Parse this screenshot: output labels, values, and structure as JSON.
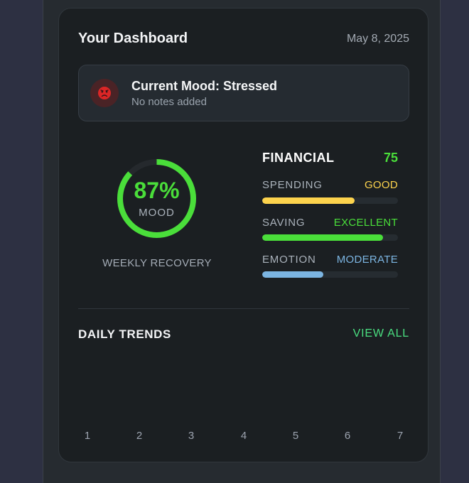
{
  "header": {
    "title": "Your Dashboard",
    "date": "May 8, 2025"
  },
  "current_mood": {
    "title": "Current Mood: Stressed",
    "notes": "No notes added",
    "icon": "stressed-face-icon",
    "icon_color": "#dc2626"
  },
  "mood_ring": {
    "percent": 87,
    "percent_label": "87%",
    "label": "MOOD",
    "caption": "WEEKLY RECOVERY",
    "color": "#4ade3a"
  },
  "financial": {
    "title": "FINANCIAL",
    "score": "75",
    "metrics": [
      {
        "label": "SPENDING",
        "rating": "GOOD",
        "level": 0.68,
        "color": "#fcd34d"
      },
      {
        "label": "SAVING",
        "rating": "EXCELLENT",
        "level": 0.89,
        "color": "#4ade3a"
      },
      {
        "label": "EMOTION",
        "rating": "MODERATE",
        "level": 0.45,
        "color": "#7cb5e2"
      }
    ]
  },
  "trends": {
    "title": "DAILY TRENDS",
    "view_all": "VIEW ALL",
    "days": [
      "1",
      "2",
      "3",
      "4",
      "5",
      "6",
      "7"
    ]
  }
}
